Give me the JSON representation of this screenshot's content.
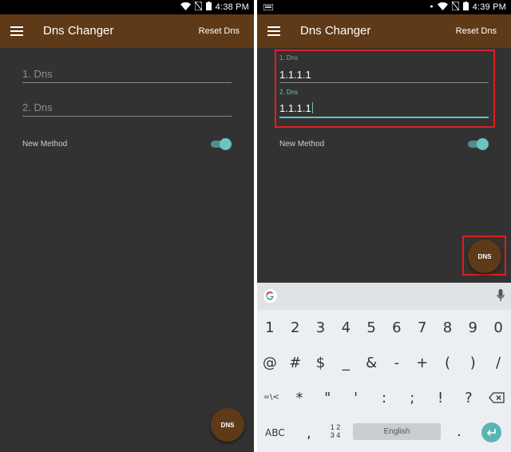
{
  "left": {
    "status_time": "4:38 PM",
    "app_title": "Dns Changer",
    "reset_label": "Reset Dns",
    "dns1_placeholder": "1. Dns",
    "dns2_placeholder": "2. Dns",
    "method_label": "New Method",
    "fab_label": "DNS"
  },
  "right": {
    "status_time": "4:39 PM",
    "app_title": "Dns Changer",
    "reset_label": "Reset Dns",
    "dns1_label": "1. Dns",
    "dns1_value": "1.1.1.1",
    "dns2_label": "2. Dns",
    "dns2_value": "1.1.1.1",
    "method_label": "New Method",
    "fab_label": "DNS"
  },
  "keyboard": {
    "row_numbers": [
      "1",
      "2",
      "3",
      "4",
      "5",
      "6",
      "7",
      "8",
      "9",
      "0"
    ],
    "row_symbols1": [
      "@",
      "#",
      "$",
      "_",
      "&",
      "-",
      "+",
      "(",
      ")",
      "/"
    ],
    "row_symbols2": [
      "=\\<",
      "*",
      "\"",
      "'",
      ":",
      ";",
      "!",
      "?"
    ],
    "abc_label": "ABC",
    "comma": ",",
    "numpad_top": "1 2",
    "numpad_bottom": "3 4",
    "space_label": "English",
    "period": "."
  },
  "colors": {
    "appbar": "#5e3a18",
    "background": "#323232",
    "accent": "#6cc3c0",
    "highlight": "#e01e1e"
  }
}
